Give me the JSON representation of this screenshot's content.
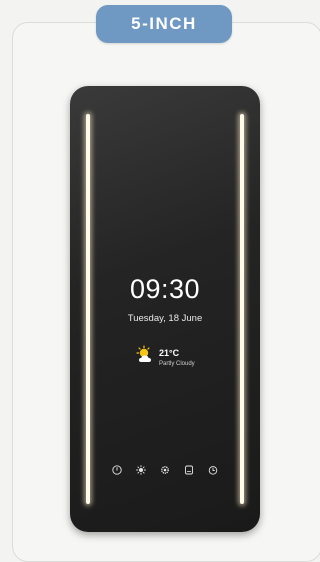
{
  "badge": {
    "label": "5-INCH"
  },
  "display": {
    "time": "09:30",
    "date": "Tuesday, 18 June",
    "weather": {
      "temperature": "21°C",
      "condition": "Partly Cloudy",
      "icon": "partly-cloudy-icon"
    },
    "controls": [
      "power-icon",
      "light-icon",
      "settings-icon",
      "mirror-icon",
      "timer-icon"
    ]
  },
  "colors": {
    "badge": "#6f98c2",
    "mirror": "#242424",
    "light_strip": "#fffbea",
    "sun": "#f5c518"
  }
}
